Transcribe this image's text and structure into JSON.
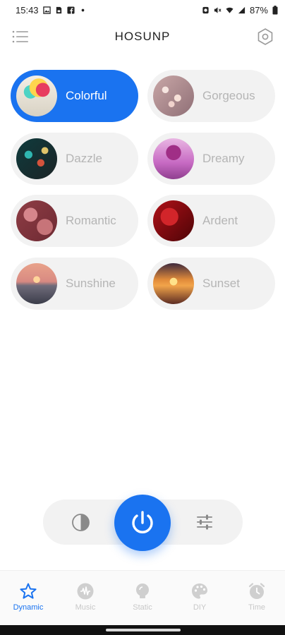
{
  "status_bar": {
    "time": "15:43",
    "battery": "87%",
    "notification_icons": [
      "image-icon",
      "sim-icon",
      "facebook-icon",
      "dot-icon"
    ],
    "system_icons": [
      "alarm-icon",
      "mute-icon",
      "wifi-icon",
      "signal-icon",
      "battery-icon"
    ]
  },
  "header": {
    "title": "HOSUNP",
    "menu_icon": "menu-icon",
    "settings_icon": "hexagon-settings-icon"
  },
  "modes": [
    {
      "label": "Colorful",
      "active": true
    },
    {
      "label": "Gorgeous",
      "active": false
    },
    {
      "label": "Dazzle",
      "active": false
    },
    {
      "label": "Dreamy",
      "active": false
    },
    {
      "label": "Romantic",
      "active": false
    },
    {
      "label": "Ardent",
      "active": false
    },
    {
      "label": "Sunshine",
      "active": false
    },
    {
      "label": "Sunset",
      "active": false
    }
  ],
  "controls": {
    "left_icon": "contrast-icon",
    "center_icon": "power-icon",
    "right_icon": "sliders-icon"
  },
  "tabs": [
    {
      "label": "Dynamic",
      "icon": "star-icon",
      "active": true
    },
    {
      "label": "Music",
      "icon": "music-icon",
      "active": false
    },
    {
      "label": "Static",
      "icon": "bulb-icon",
      "active": false
    },
    {
      "label": "DIY",
      "icon": "palette-icon",
      "active": false
    },
    {
      "label": "Time",
      "icon": "clock-icon",
      "active": false
    }
  ],
  "colors": {
    "accent": "#1a73f0",
    "card_bg": "#f2f2f2",
    "inactive_text": "#b5b5b5",
    "inactive_tab": "#c8c8c8"
  }
}
